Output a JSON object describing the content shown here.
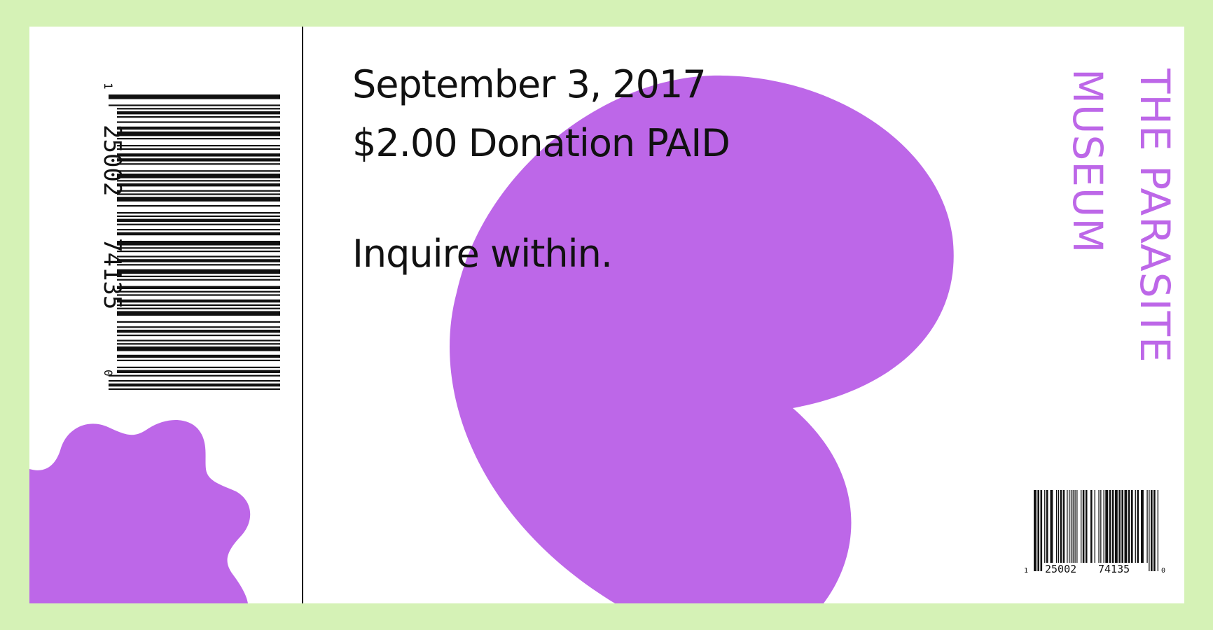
{
  "ticket": {
    "date": "September 3, 2017",
    "payment": "$2.00 Donation PAID",
    "note": "Inquire within."
  },
  "museum": {
    "name_line_1": "THE PARASITE",
    "name_line_2": "MUSEUM"
  },
  "barcode": {
    "lead_digit": "1",
    "group_1": "25002",
    "group_2": "74135",
    "trail_digit": "0"
  },
  "colors": {
    "background": "#d5f2b6",
    "ticket": "#ffffff",
    "accent": "#bd67e8",
    "ink": "#111111"
  }
}
